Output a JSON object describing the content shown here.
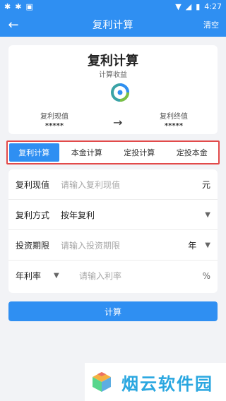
{
  "status_bar": {
    "time": "4:27",
    "left_icons": [
      "bug-icon",
      "bug-icon",
      "app-icon"
    ],
    "right_icons": [
      "wifi-icon",
      "signal-icon",
      "battery-icon"
    ]
  },
  "app_bar": {
    "title": "复利计算",
    "clear_label": "清空",
    "accent": "#2f8ff2"
  },
  "summary": {
    "title": "复利计算",
    "subtitle": "计算收益",
    "present_value_label": "复利现值",
    "present_value": "*****",
    "future_value_label": "复利终值",
    "future_value": "*****",
    "arrow": "→"
  },
  "tabs": [
    {
      "label": "复利计算",
      "active": true
    },
    {
      "label": "本金计算",
      "active": false
    },
    {
      "label": "定投计算",
      "active": false
    },
    {
      "label": "定投本金",
      "active": false
    }
  ],
  "form": {
    "present_value": {
      "label": "复利现值",
      "placeholder": "请输入复利现值",
      "unit": "元"
    },
    "compound_method": {
      "label": "复利方式",
      "value": "按年复利"
    },
    "investment_period": {
      "label": "投资期限",
      "placeholder": "请输入投资期限",
      "unit_select": "年"
    },
    "annual_rate": {
      "label": "年利率",
      "placeholder": "请输入利率",
      "unit": "%"
    }
  },
  "calc_button": {
    "label": "计算"
  },
  "watermark": {
    "text": "烟云软件园"
  }
}
